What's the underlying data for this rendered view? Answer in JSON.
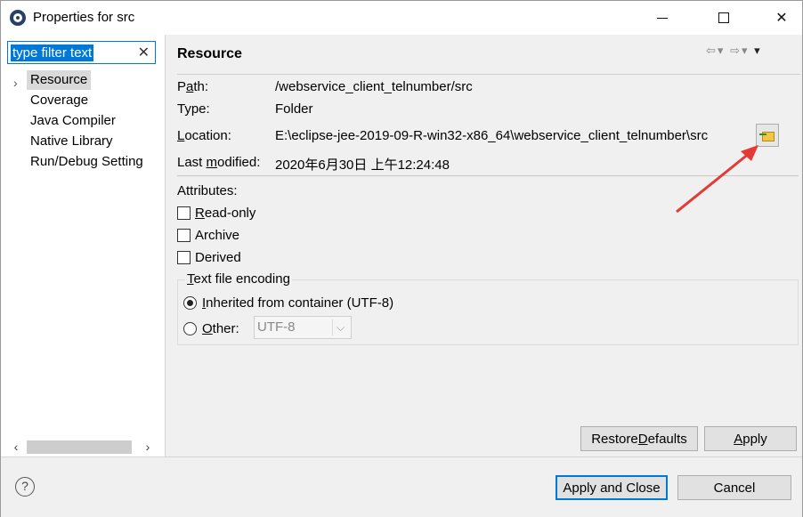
{
  "window": {
    "title": "Properties for src",
    "icon": "eclipse-icon"
  },
  "filter": {
    "placeholder_selected": "type filter text"
  },
  "tree": {
    "items": [
      {
        "label": "Resource",
        "selected": true
      },
      {
        "label": "Coverage"
      },
      {
        "label": "Java Compiler"
      },
      {
        "label": "Native Library"
      },
      {
        "label": "Run/Debug Setting"
      }
    ]
  },
  "resource": {
    "title": "Resource",
    "path_label_pre": "P",
    "path_label_ul": "a",
    "path_label_post": "th:",
    "path_value": "/webservice_client_telnumber/src",
    "type_label": "Type:",
    "type_value": "Folder",
    "location_label_ul": "L",
    "location_label_post": "ocation:",
    "location_value": "E:\\eclipse-jee-2019-09-R-win32-x86_64\\webservice_client_telnumber\\src",
    "modified_label_pre": "Last ",
    "modified_label_ul": "m",
    "modified_label_post": "odified:",
    "modified_value": "2020年6月30日 上午12:24:48",
    "attributes_label": "Attributes:",
    "attrs": [
      {
        "ul": "R",
        "rest": "ead-only"
      },
      {
        "ul": "",
        "rest": "Archive"
      },
      {
        "ul": "",
        "rest": "Derived"
      }
    ],
    "encoding_legend_ul": "T",
    "encoding_legend_rest": "ext file encoding",
    "inherited_ul": "I",
    "inherited_rest": "nherited from container (UTF-8)",
    "other_ul": "O",
    "other_rest": "ther:",
    "other_select_value": "UTF-8"
  },
  "buttons": {
    "restore_pre": "Restore ",
    "restore_ul": "D",
    "restore_post": "efaults",
    "apply_ul": "A",
    "apply_post": "pply",
    "apply_close": "Apply and Close",
    "cancel": "Cancel"
  },
  "colors": {
    "selection": "#0078d7",
    "annotation_arrow": "#e53935"
  }
}
